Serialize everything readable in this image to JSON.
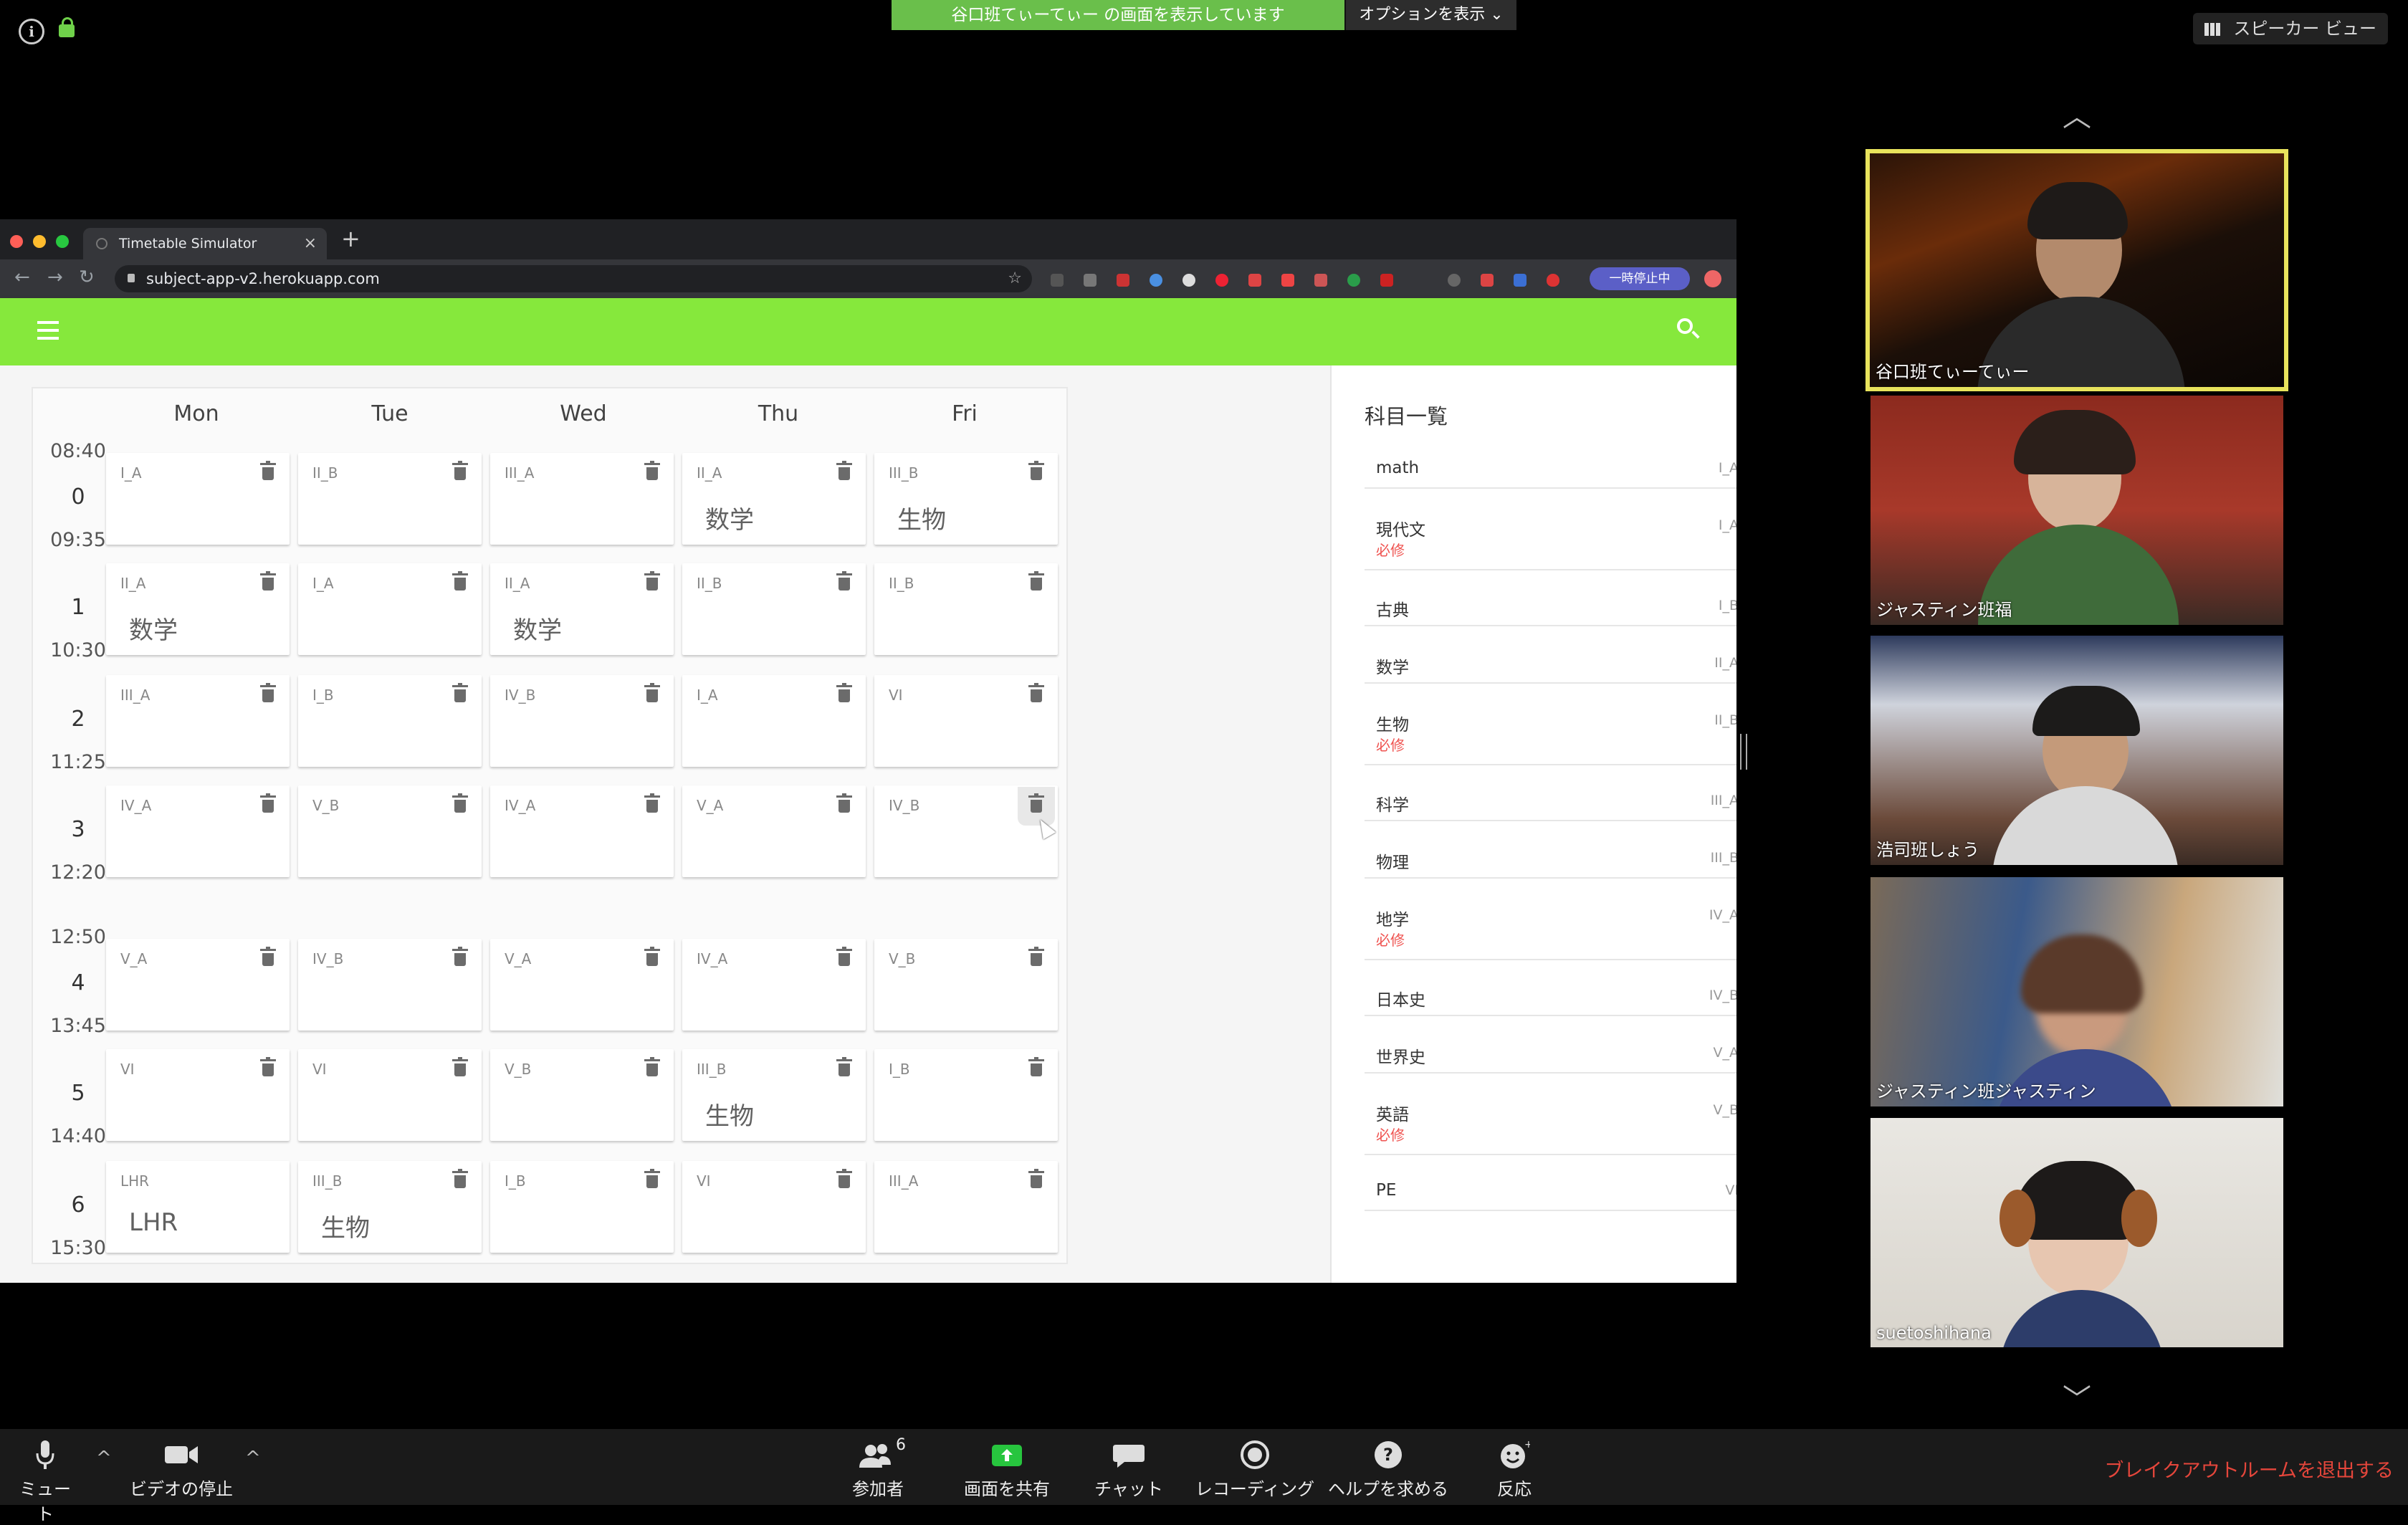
{
  "zoom": {
    "share_banner": "谷口班てぃーてぃー の画面を表示しています",
    "options_label": "オプションを表示 ⌄",
    "speaker_view_label": "スピーカー ビュー",
    "participants": [
      {
        "name": "谷口班てぃーてぃー",
        "active": true
      },
      {
        "name": "ジャスティン班福"
      },
      {
        "name": "浩司班しょう"
      },
      {
        "name": "ジャスティン班ジャスティン"
      },
      {
        "name": "suetoshihana"
      }
    ],
    "controls": {
      "mute": "ミュート",
      "stop_video": "ビデオの停止",
      "participants": "参加者",
      "participants_count": "6",
      "share_screen": "画面を共有",
      "chat": "チャット",
      "recording": "レコーディング",
      "help": "ヘルプを求める",
      "reactions": "反応",
      "leave_breakout": "ブレイクアウトルームを退出する"
    }
  },
  "browser": {
    "tab_title": "Timetable Simulator",
    "url": "subject-app-v2.herokuapp.com",
    "paused_label": "一時停止中"
  },
  "timetable": {
    "days": [
      "Mon",
      "Tue",
      "Wed",
      "Thu",
      "Fri"
    ],
    "periods": [
      {
        "num": "0",
        "start": "08:40",
        "end": "09:35"
      },
      {
        "num": "1",
        "end": "10:30"
      },
      {
        "num": "2",
        "end": "11:25"
      },
      {
        "num": "3",
        "end": "12:20"
      },
      {
        "num": "4",
        "start": "12:50",
        "end": "13:45"
      },
      {
        "num": "5",
        "end": "14:40"
      },
      {
        "num": "6",
        "end": "15:30"
      }
    ],
    "rows": [
      [
        {
          "code": "I_A",
          "subject": ""
        },
        {
          "code": "II_B",
          "subject": ""
        },
        {
          "code": "III_A",
          "subject": ""
        },
        {
          "code": "II_A",
          "subject": "数学"
        },
        {
          "code": "III_B",
          "subject": "生物"
        }
      ],
      [
        {
          "code": "II_A",
          "subject": "数学"
        },
        {
          "code": "I_A",
          "subject": ""
        },
        {
          "code": "II_A",
          "subject": "数学"
        },
        {
          "code": "II_B",
          "subject": ""
        },
        {
          "code": "II_B",
          "subject": ""
        }
      ],
      [
        {
          "code": "III_A",
          "subject": ""
        },
        {
          "code": "I_B",
          "subject": ""
        },
        {
          "code": "IV_B",
          "subject": ""
        },
        {
          "code": "I_A",
          "subject": ""
        },
        {
          "code": "VI",
          "subject": ""
        }
      ],
      [
        {
          "code": "IV_A",
          "subject": ""
        },
        {
          "code": "V_B",
          "subject": ""
        },
        {
          "code": "IV_A",
          "subject": ""
        },
        {
          "code": "V_A",
          "subject": ""
        },
        {
          "code": "IV_B",
          "subject": ""
        }
      ],
      [
        {
          "code": "V_A",
          "subject": ""
        },
        {
          "code": "IV_B",
          "subject": ""
        },
        {
          "code": "V_A",
          "subject": ""
        },
        {
          "code": "IV_A",
          "subject": ""
        },
        {
          "code": "V_B",
          "subject": ""
        }
      ],
      [
        {
          "code": "VI",
          "subject": ""
        },
        {
          "code": "VI",
          "subject": ""
        },
        {
          "code": "V_B",
          "subject": ""
        },
        {
          "code": "III_B",
          "subject": "生物"
        },
        {
          "code": "I_B",
          "subject": ""
        }
      ],
      [
        {
          "code": "LHR",
          "subject": "LHR"
        },
        {
          "code": "III_B",
          "subject": "生物"
        },
        {
          "code": "I_B",
          "subject": ""
        },
        {
          "code": "VI",
          "subject": ""
        },
        {
          "code": "III_A",
          "subject": ""
        }
      ]
    ]
  },
  "subject_panel": {
    "title": "科目一覧",
    "required_label": "必修",
    "items": [
      {
        "name": "math",
        "code": "I_A",
        "required": false
      },
      {
        "name": "現代文",
        "code": "I_A",
        "required": true
      },
      {
        "name": "古典",
        "code": "I_B",
        "required": false
      },
      {
        "name": "数学",
        "code": "II_A",
        "required": false
      },
      {
        "name": "生物",
        "code": "II_B",
        "required": true
      },
      {
        "name": "科学",
        "code": "III_A",
        "required": false
      },
      {
        "name": "物理",
        "code": "III_B",
        "required": false
      },
      {
        "name": "地学",
        "code": "IV_A",
        "required": true
      },
      {
        "name": "日本史",
        "code": "IV_B",
        "required": false
      },
      {
        "name": "世界史",
        "code": "V_A",
        "required": false
      },
      {
        "name": "英語",
        "code": "V_B",
        "required": true
      },
      {
        "name": "PE",
        "code": "VI",
        "required": false
      }
    ]
  }
}
